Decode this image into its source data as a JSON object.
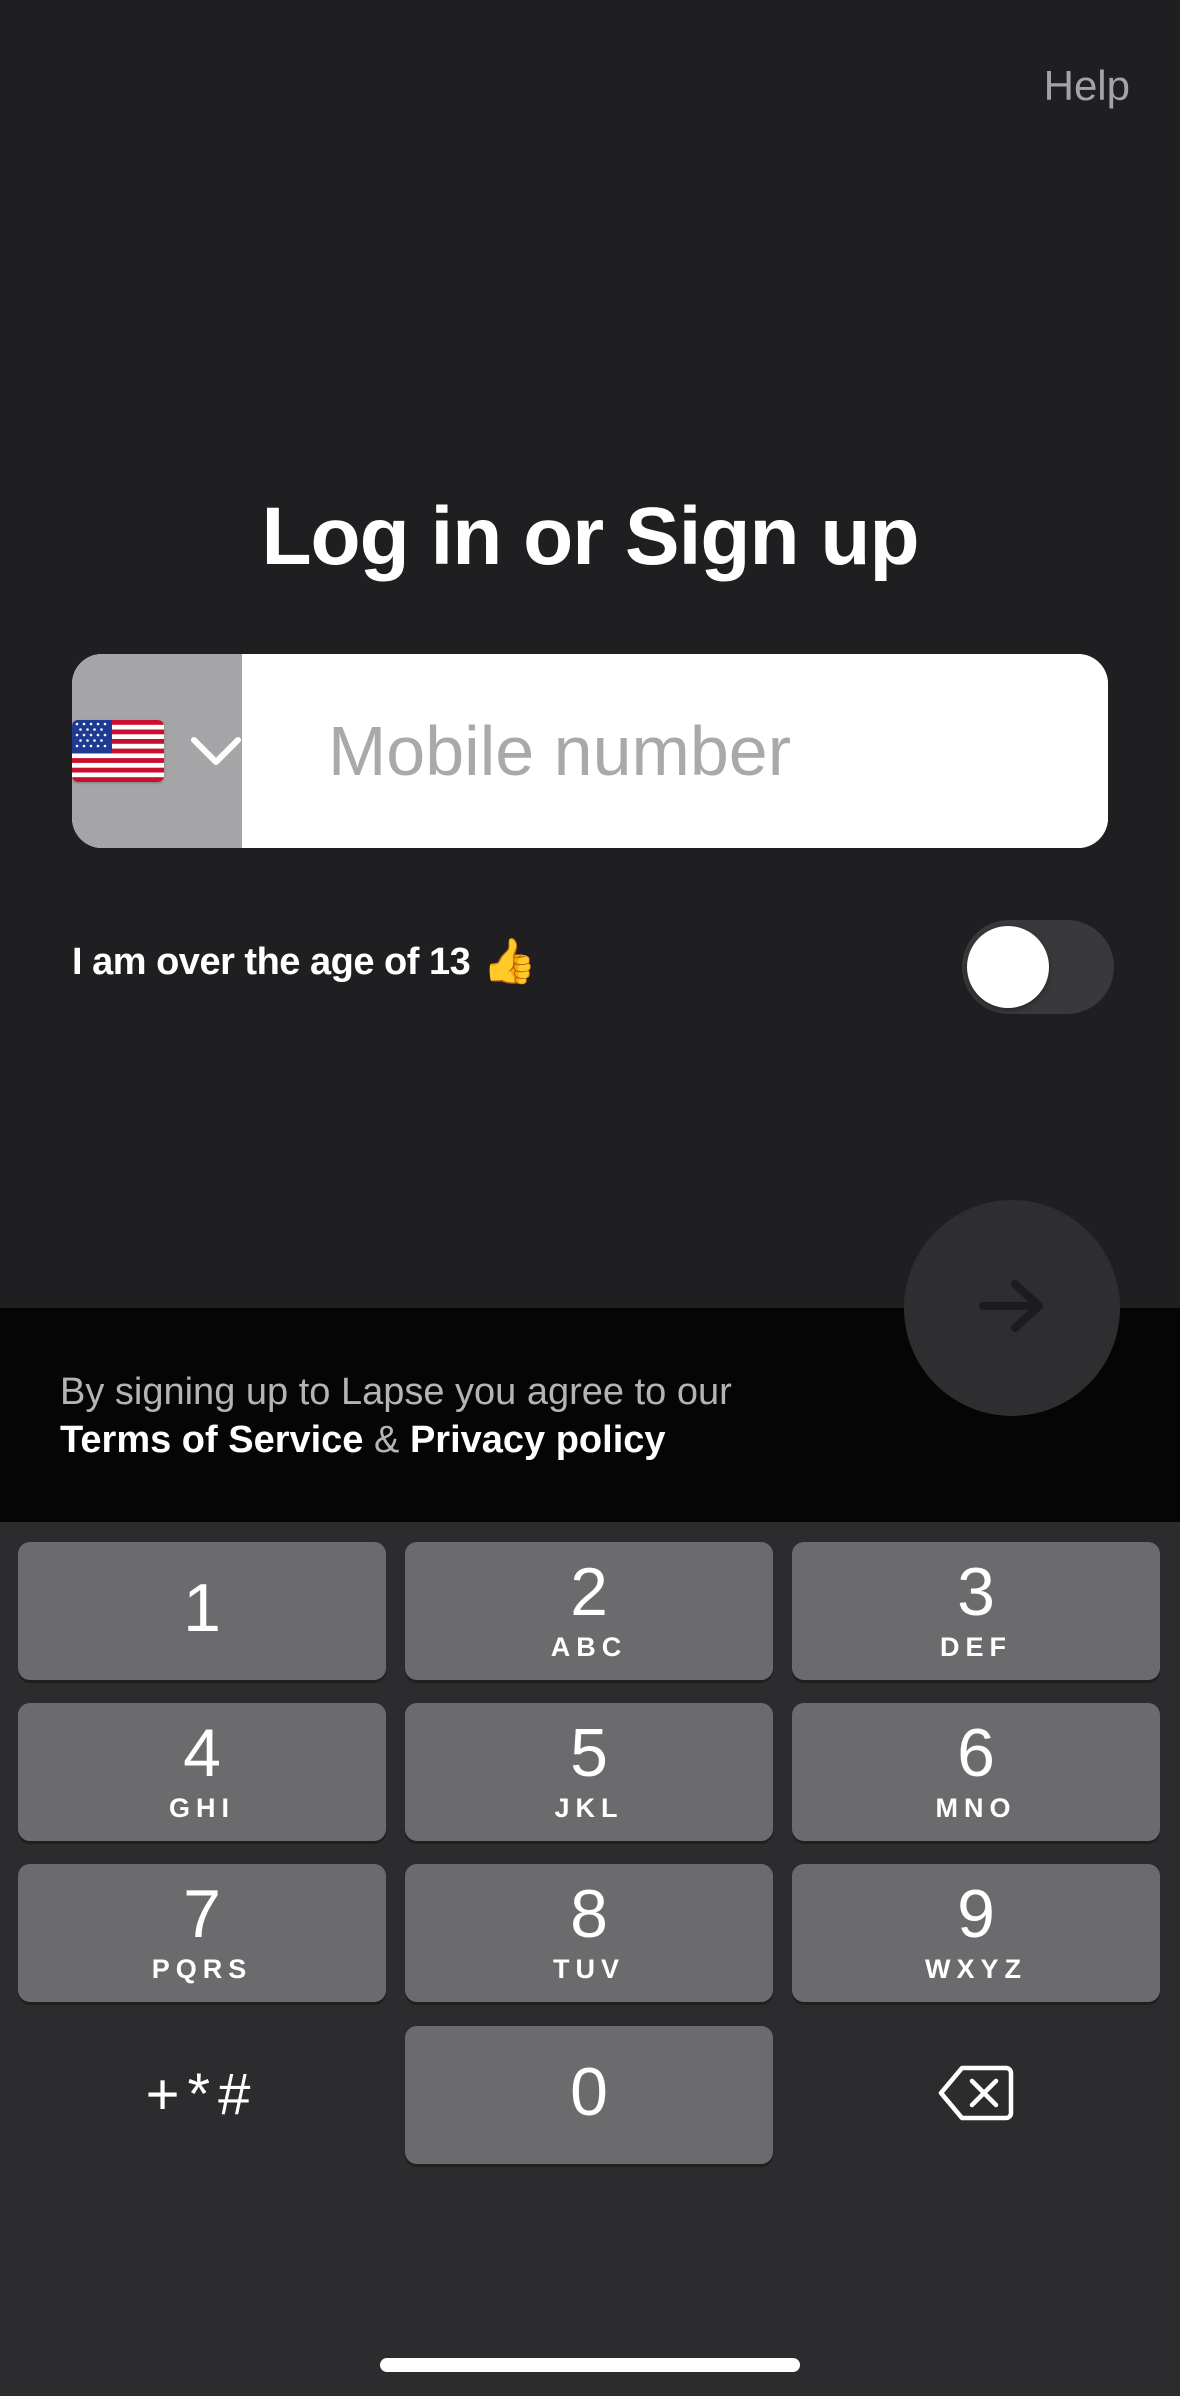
{
  "header": {
    "help_label": "Help"
  },
  "main": {
    "title": "Log in or Sign up",
    "phone": {
      "country_flag": "us-flag",
      "placeholder": "Mobile number",
      "value": ""
    },
    "age_toggle": {
      "label": "I am over the age of 13",
      "emoji": "👍",
      "checked": false
    }
  },
  "terms": {
    "prefix": "By signing up to Lapse you agree to our",
    "tos_label": "Terms of Service",
    "ampersand": "&",
    "privacy_label": "Privacy policy"
  },
  "next_button": {
    "icon": "arrow-right-icon"
  },
  "keypad": {
    "keys": [
      {
        "digit": "1",
        "letters": ""
      },
      {
        "digit": "2",
        "letters": "ABC"
      },
      {
        "digit": "3",
        "letters": "DEF"
      },
      {
        "digit": "4",
        "letters": "GHI"
      },
      {
        "digit": "5",
        "letters": "JKL"
      },
      {
        "digit": "6",
        "letters": "MNO"
      },
      {
        "digit": "7",
        "letters": "PQRS"
      },
      {
        "digit": "8",
        "letters": "TUV"
      },
      {
        "digit": "9",
        "letters": "WXYZ"
      },
      {
        "digit": "0",
        "letters": ""
      }
    ],
    "symbols_label": "+*#",
    "backspace_icon": "backspace-icon"
  },
  "colors": {
    "background": "#1f1f21",
    "keyboard_bg": "#2c2c2e",
    "key_bg": "#6b6b6e",
    "terms_band": "#050505",
    "country_selector_bg": "#a5a5a7"
  }
}
